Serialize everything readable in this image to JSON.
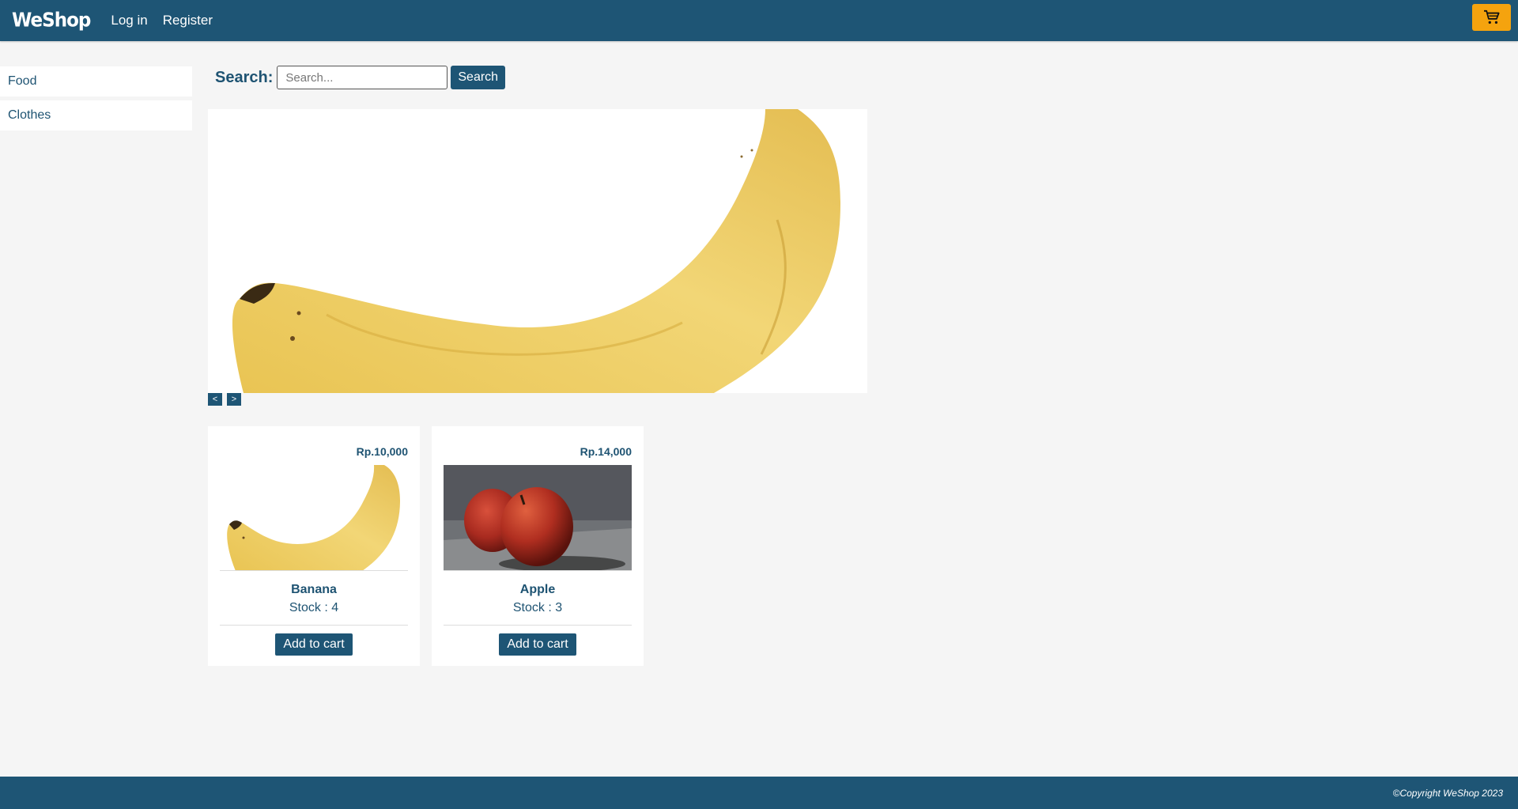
{
  "navbar": {
    "brand": "WeShop",
    "links": [
      "Log in",
      "Register"
    ],
    "cart_icon": "cart-icon",
    "cart_color": "#f5a30e"
  },
  "sidebar": {
    "items": [
      {
        "label": "Food"
      },
      {
        "label": "Clothes"
      }
    ]
  },
  "search": {
    "label": "Search:",
    "placeholder": "Search...",
    "value": "",
    "button_label": "Search"
  },
  "carousel": {
    "image": "banana",
    "prev_label": "<",
    "next_label": ">"
  },
  "products": [
    {
      "price": "Rp.10,000",
      "image": "banana",
      "name": "Banana",
      "stock": "Stock : 4",
      "button": "Add to cart"
    },
    {
      "price": "Rp.14,000",
      "image": "apple",
      "name": "Apple",
      "stock": "Stock : 3",
      "button": "Add to cart"
    }
  ],
  "footer": {
    "copyright": "©Copyright WeShop 2023"
  },
  "colors": {
    "primary": "#1e5575",
    "accent": "#f5a30e",
    "background": "#f5f5f5"
  }
}
